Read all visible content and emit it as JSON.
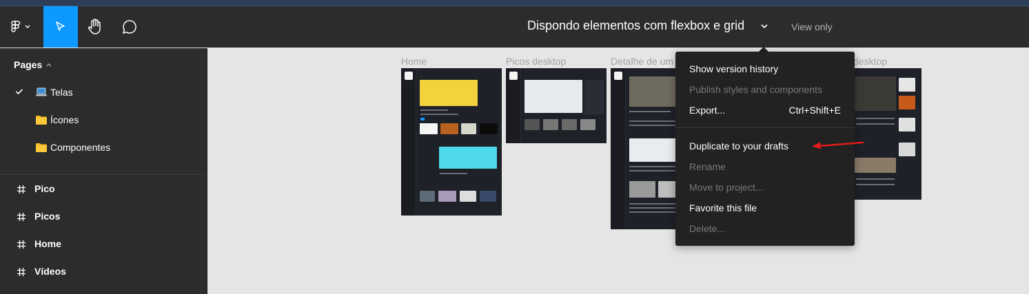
{
  "toolbar": {
    "file_title": "Dispondo elementos com flexbox e grid",
    "view_only": "View only",
    "tools": [
      "main-menu-icon",
      "move-icon",
      "hand-icon",
      "comment-icon"
    ]
  },
  "sidebar": {
    "pages_label": "Pages",
    "pages": [
      {
        "label": "Telas",
        "icon": "laptop-icon",
        "selected": true
      },
      {
        "label": "Ícones",
        "icon": "folder-icon",
        "selected": false
      },
      {
        "label": "Componentes",
        "icon": "folder-icon",
        "selected": false
      }
    ],
    "layers": [
      {
        "label": "Pico"
      },
      {
        "label": "Picos"
      },
      {
        "label": "Home"
      },
      {
        "label": "Vídeos"
      }
    ]
  },
  "canvas": {
    "frames": [
      {
        "label": "Home"
      },
      {
        "label": "Picos desktop"
      },
      {
        "label": "Detalhe de um"
      },
      {
        "label": "desktop"
      }
    ]
  },
  "menu": {
    "items": [
      {
        "label": "Show version history",
        "enabled": true
      },
      {
        "label": "Publish styles and components",
        "enabled": false
      },
      {
        "label": "Export...",
        "enabled": true,
        "shortcut": "Ctrl+Shift+E"
      },
      {
        "label": "Duplicate to your drafts",
        "enabled": true
      },
      {
        "label": "Rename",
        "enabled": false
      },
      {
        "label": "Move to project...",
        "enabled": false
      },
      {
        "label": "Favorite this file",
        "enabled": true
      },
      {
        "label": "Delete...",
        "enabled": false
      }
    ]
  },
  "colors": {
    "accent": "#0d99ff",
    "annotation_arrow": "#e21b1b"
  }
}
